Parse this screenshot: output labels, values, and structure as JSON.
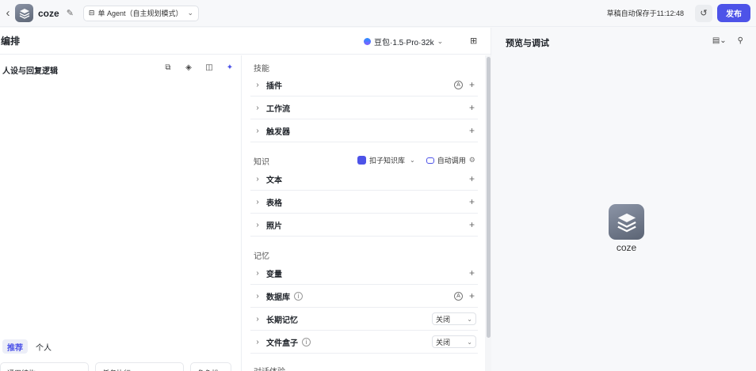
{
  "header": {
    "back_icon": "chevron-left-icon",
    "app_name": "coze",
    "mode_label": "单 Agent（自主规划模式）",
    "autosave_text": "草稿自动保存于11:12:48",
    "publish_label": "发布"
  },
  "editor": {
    "title": "编排",
    "model_name": "豆包·1.5·Pro·32k"
  },
  "persona": {
    "title": "人设与回复逻辑",
    "tabs": [
      "推荐",
      "个人"
    ],
    "templates": [
      "通用结构",
      "任务执行",
      "角色扮"
    ]
  },
  "skills": {
    "skills_label": "技能",
    "plugins": "插件",
    "workflow": "工作流",
    "trigger": "触发器",
    "knowledge_label": "知识",
    "kb_source": "扣子知识库",
    "auto_call": "自动调用",
    "text": "文本",
    "table": "表格",
    "photo": "照片",
    "memory_label": "记忆",
    "variables": "变量",
    "database": "数据库",
    "long_memory": "长期记忆",
    "long_memory_value": "关闭",
    "file_box": "文件盒子",
    "file_box_value": "关闭",
    "dialog_label": "对话体验"
  },
  "preview": {
    "title": "预览与调试",
    "bot_name": "coze"
  },
  "colors": {
    "accent": "#4d53e8",
    "background": "#f7f8fa"
  }
}
